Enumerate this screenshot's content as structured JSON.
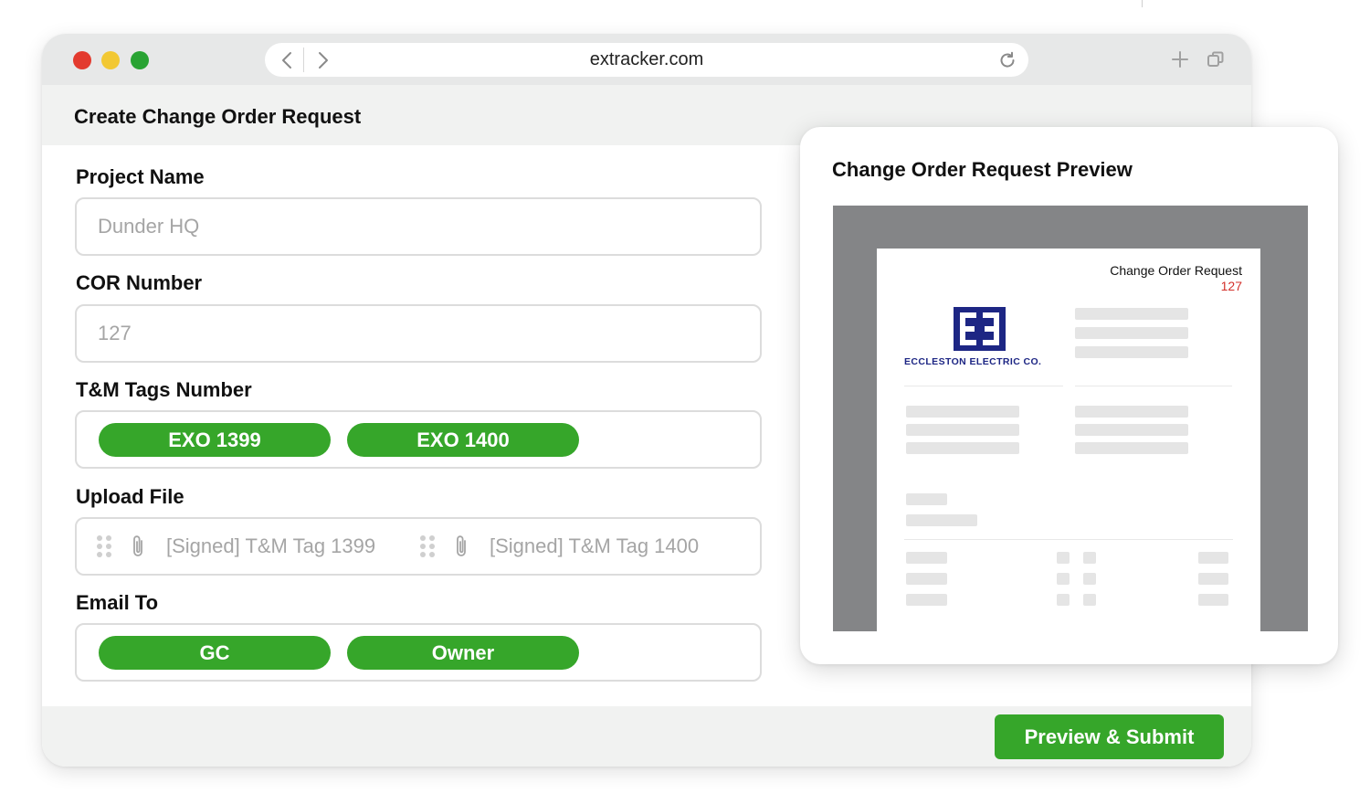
{
  "browser": {
    "url": "extracker.com"
  },
  "page": {
    "title": "Create Change Order Request"
  },
  "form": {
    "project_name": {
      "label": "Project Name",
      "value": "Dunder HQ"
    },
    "cor_number": {
      "label": "COR Number",
      "value": "127"
    },
    "tm_tags": {
      "label": "T&M Tags Number",
      "chips": [
        "EXO 1399",
        "EXO 1400"
      ]
    },
    "upload": {
      "label": "Upload File",
      "files": [
        "[Signed] T&M Tag 1399",
        "[Signed] T&M Tag 1400"
      ]
    },
    "email_to": {
      "label": "Email To",
      "chips": [
        "GC",
        "Owner"
      ]
    }
  },
  "footer": {
    "submit_label": "Preview & Submit"
  },
  "preview": {
    "title": "Change Order Request Preview",
    "doc_title": "Change Order Request",
    "doc_number": "127",
    "company_name": "ECCLESTON ELECTRIC CO."
  },
  "colors": {
    "accent_green": "#36a62a",
    "logo_navy": "#1d2684",
    "number_red": "#d3302b"
  }
}
